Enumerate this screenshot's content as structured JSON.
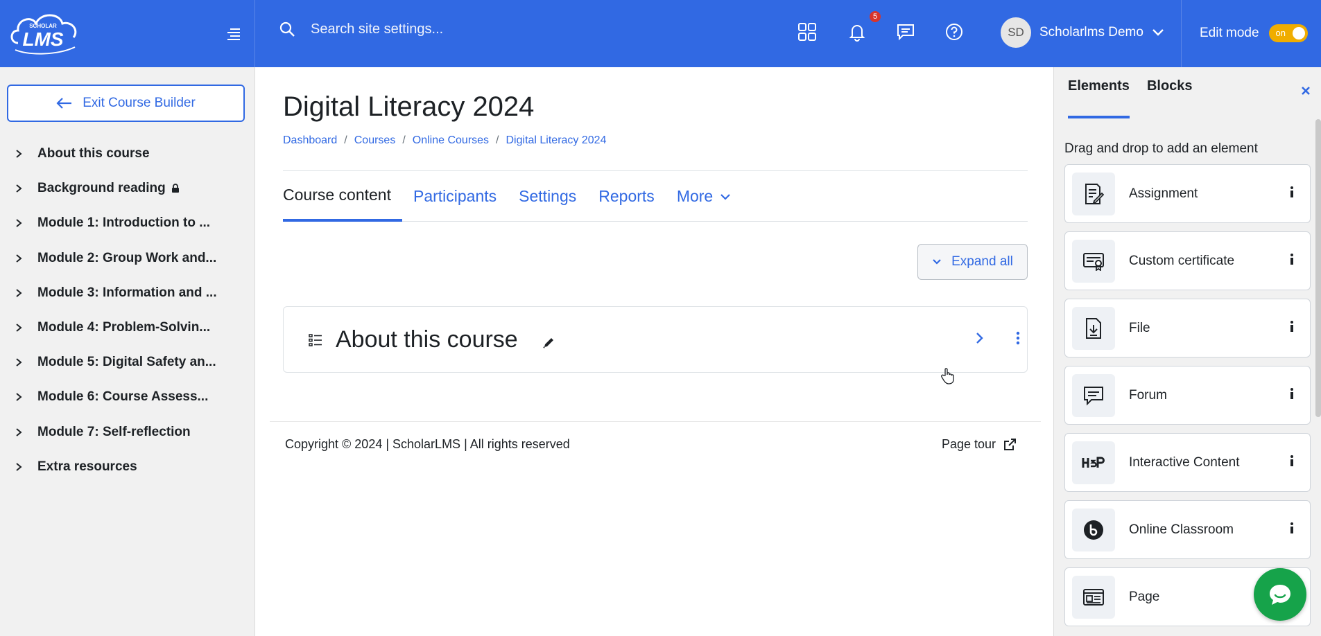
{
  "navbar": {
    "logo_top": "SCHOLAR",
    "logo_main": "LMS",
    "search_placeholder": "Search site settings...",
    "notifications_count": "5",
    "user_initials": "SD",
    "user_name": "Scholarlms Demo",
    "edit_mode_label": "Edit mode",
    "edit_mode_state": "on"
  },
  "sidebar": {
    "exit_label": "Exit Course Builder",
    "items": [
      {
        "label": "About this course"
      },
      {
        "label": "Background reading"
      },
      {
        "label": "Module 1: Introduction to ..."
      },
      {
        "label": "Module 2: Group Work and..."
      },
      {
        "label": "Module 3: Information and ..."
      },
      {
        "label": "Module 4: Problem-Solvin..."
      },
      {
        "label": "Module 5: Digital Safety an..."
      },
      {
        "label": "Module 6: Course Assess..."
      },
      {
        "label": "Module 7: Self-reflection"
      },
      {
        "label": "Extra resources"
      }
    ]
  },
  "main": {
    "title": "Digital Literacy 2024",
    "breadcrumb": [
      "Dashboard",
      "Courses",
      "Online Courses",
      "Digital Literacy 2024"
    ],
    "breadcrumb_sep": "/",
    "tabs": [
      {
        "label": "Course content"
      },
      {
        "label": "Participants"
      },
      {
        "label": "Settings"
      },
      {
        "label": "Reports"
      },
      {
        "label": "More"
      }
    ],
    "expand_all_label": "Expand all",
    "section_title": "About this course",
    "copyright": "Copyright © 2024 | ScholarLMS | All rights reserved",
    "page_tour": "Page tour"
  },
  "drawer": {
    "tabs": [
      "Elements",
      "Blocks"
    ],
    "hint": "Drag and drop to add an element",
    "elements": [
      {
        "label": "Assignment",
        "icon": "assignment-icon"
      },
      {
        "label": "Custom certificate",
        "icon": "certificate-icon"
      },
      {
        "label": "File",
        "icon": "file-icon"
      },
      {
        "label": "Forum",
        "icon": "forum-icon"
      },
      {
        "label": "Interactive Content",
        "icon": "h5p-icon"
      },
      {
        "label": "Online Classroom",
        "icon": "bigbluebutton-icon"
      },
      {
        "label": "Page",
        "icon": "page-icon"
      }
    ]
  },
  "colors": {
    "primary": "#3169e3",
    "toggle": "#f0ad00",
    "badge": "#d9342b",
    "chat": "#16a34a"
  }
}
